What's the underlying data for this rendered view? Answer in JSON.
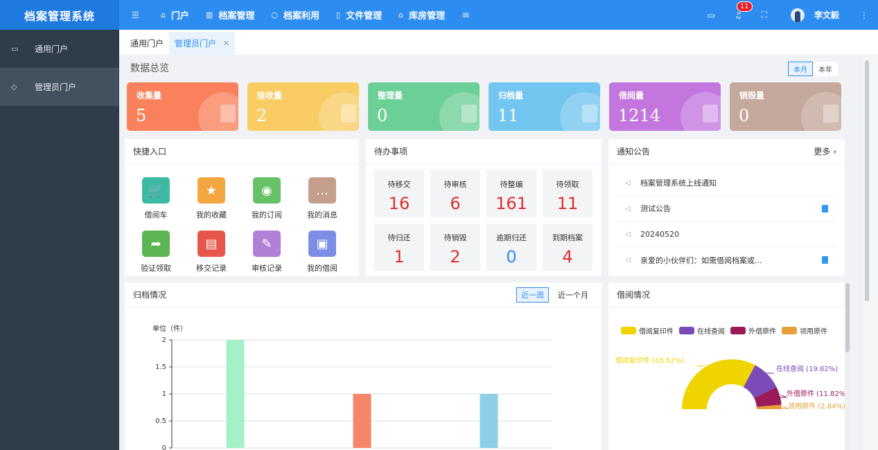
{
  "app": {
    "title": "档案管理系统"
  },
  "nav": {
    "items": [
      {
        "label": "门户",
        "icon": "home-icon"
      },
      {
        "label": "档案管理",
        "icon": "archive-icon"
      },
      {
        "label": "档案利用",
        "icon": "search-icon"
      },
      {
        "label": "文件管理",
        "icon": "file-icon"
      },
      {
        "label": "库房管理",
        "icon": "warehouse-icon"
      }
    ]
  },
  "header": {
    "notification_count": "11",
    "username": "李文毅"
  },
  "sidebar": {
    "items": [
      {
        "label": "通用门户"
      },
      {
        "label": "管理员门户"
      }
    ]
  },
  "tabs": [
    {
      "label": "通用门户"
    },
    {
      "label": "管理员门户"
    }
  ],
  "overview": {
    "title": "数据总览",
    "period": [
      "本月",
      "本年"
    ],
    "stats": [
      {
        "label": "收集量",
        "value": "5",
        "color": "#f9825c"
      },
      {
        "label": "接收量",
        "value": "2",
        "color": "#f9cc64"
      },
      {
        "label": "整理量",
        "value": "0",
        "color": "#6dcf98"
      },
      {
        "label": "归档量",
        "value": "11",
        "color": "#73c6ef"
      },
      {
        "label": "借阅量",
        "value": "1214",
        "color": "#c276de"
      },
      {
        "label": "销毁量",
        "value": "0",
        "color": "#c4a89b"
      }
    ]
  },
  "quick": {
    "title": "快捷入口",
    "items": [
      {
        "label": "借阅车",
        "color": "#3dbaa3",
        "icon": "cart-icon"
      },
      {
        "label": "我的收藏",
        "color": "#f4a640",
        "icon": "star-icon"
      },
      {
        "label": "我的订阅",
        "color": "#67c166",
        "icon": "rss-icon"
      },
      {
        "label": "我的消息",
        "color": "#c4a08c",
        "icon": "message-icon"
      },
      {
        "label": "验证领取",
        "color": "#5ab552",
        "icon": "share-icon"
      },
      {
        "label": "移交记录",
        "color": "#e6564a",
        "icon": "document-icon"
      },
      {
        "label": "审核记录",
        "color": "#b27fd6",
        "icon": "audit-icon"
      },
      {
        "label": "我的借阅",
        "color": "#7c8de6",
        "icon": "id-card-icon"
      }
    ]
  },
  "todo": {
    "title": "待办事项",
    "items": [
      {
        "label": "待移交",
        "value": "16"
      },
      {
        "label": "待审核",
        "value": "6"
      },
      {
        "label": "待整编",
        "value": "161"
      },
      {
        "label": "待领取",
        "value": "11"
      },
      {
        "label": "待归还",
        "value": "1"
      },
      {
        "label": "待销毁",
        "value": "2"
      },
      {
        "label": "逾期归还",
        "value": "0"
      },
      {
        "label": "到期档案",
        "value": "4"
      }
    ]
  },
  "notices": {
    "title": "通知公告",
    "more": "更多",
    "items": [
      {
        "text": "档案管理系统上线通知"
      },
      {
        "text": "测试公告"
      },
      {
        "text": "20240520"
      },
      {
        "text": "亲爱的小伙伴们：如需借阅档案或..."
      }
    ]
  },
  "archive_chart": {
    "title": "归档情况",
    "ranges": [
      "近一周",
      "近一个月"
    ]
  },
  "borrow_chart": {
    "title": "借阅情况"
  },
  "chart_data": [
    {
      "type": "bar",
      "ylabel": "单位（件）",
      "ylim": [
        0,
        2
      ],
      "yticks": [
        "0",
        "0.5",
        "1",
        "1.5",
        "2"
      ],
      "values": [
        2,
        1,
        1
      ],
      "colors": [
        "#a3f0c9",
        "#f5866a",
        "#8ecfe8"
      ],
      "grid": true
    },
    {
      "type": "pie",
      "legend_placement": "top",
      "slices": [
        {
          "name": "借阅复印件",
          "label": "借阅复印件 (65.52%)",
          "value": 65.52,
          "color": "#f0d400"
        },
        {
          "name": "在线查阅",
          "label": "在线查阅 (19.82%)",
          "value": 19.82,
          "color": "#7b4cb8"
        },
        {
          "name": "外借原件",
          "label": "外借原件 (11.82%",
          "value": 11.82,
          "color": "#9a1a5a"
        },
        {
          "name": "领用原件",
          "label": "领用原件 (2.84%)",
          "value": 2.84,
          "color": "#e8a038"
        }
      ]
    }
  ]
}
